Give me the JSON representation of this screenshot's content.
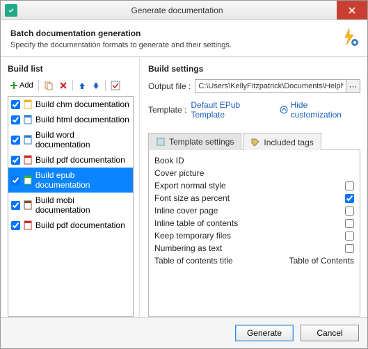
{
  "window": {
    "title": "Generate documentation"
  },
  "header": {
    "title": "Batch documentation generation",
    "subtitle": "Specify the documentation formats to generate and their settings."
  },
  "left": {
    "title": "Build list",
    "add_label": "Add",
    "items": [
      {
        "label": "Build chm documentation",
        "checked": true,
        "selected": false,
        "color": "#f2b01e"
      },
      {
        "label": "Build html documentation",
        "checked": true,
        "selected": false,
        "color": "#2e78cc"
      },
      {
        "label": "Build word documentation",
        "checked": true,
        "selected": false,
        "color": "#2e78cc"
      },
      {
        "label": "Build pdf documentation",
        "checked": true,
        "selected": false,
        "color": "#cc2e2e"
      },
      {
        "label": "Build epub documentation",
        "checked": true,
        "selected": true,
        "color": "#3cb03c"
      },
      {
        "label": "Build mobi documentation",
        "checked": true,
        "selected": false,
        "color": "#7a5230"
      },
      {
        "label": "Build pdf documentation",
        "checked": true,
        "selected": false,
        "color": "#cc2e2e"
      }
    ]
  },
  "right": {
    "title": "Build settings",
    "output_label": "Output file :",
    "output_value": "C:\\Users\\KellyFitzpatrick\\Documents\\HelpND",
    "template_label": "Template :",
    "template_value": "Default EPub Template",
    "hide_label": "Hide customization",
    "tabs": {
      "template": "Template settings",
      "tags": "Included tags"
    },
    "settings": [
      {
        "label": "Book ID",
        "type": "none"
      },
      {
        "label": "Cover picture",
        "type": "none"
      },
      {
        "label": "Export normal style",
        "type": "check",
        "checked": false
      },
      {
        "label": "Font size as percent",
        "type": "check",
        "checked": true
      },
      {
        "label": "Inline cover page",
        "type": "check",
        "checked": false
      },
      {
        "label": "Inline table of contents",
        "type": "check",
        "checked": false
      },
      {
        "label": "Keep temporary files",
        "type": "check",
        "checked": false
      },
      {
        "label": "Numbering as text",
        "type": "check",
        "checked": false
      },
      {
        "label": "Table of contents title",
        "type": "text",
        "value": "Table of Contents"
      }
    ]
  },
  "footer": {
    "generate": "Generate",
    "cancel": "Cancel"
  }
}
